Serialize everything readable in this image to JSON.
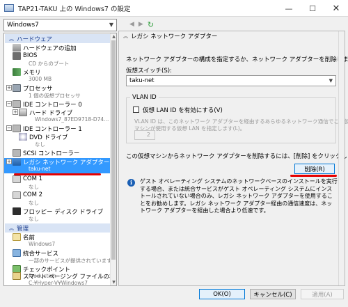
{
  "window": {
    "title": "TAP21-TAKU 上の Windows7 の設定",
    "minimize_glyph": "—",
    "maximize_glyph": "☐",
    "close_glyph": "✕"
  },
  "left": {
    "vm_select": "Windows7",
    "hardware_header": "ハードウェア",
    "management_header": "管理",
    "items": [
      {
        "label": "ハードウェアの追加",
        "sub": ""
      },
      {
        "label": "BIOS",
        "sub": "CD からのブート"
      },
      {
        "label": "メモリ",
        "sub": "3000 MB"
      },
      {
        "label": "プロセッサ",
        "sub": "1 個の仮想プロセッサ"
      },
      {
        "label": "IDE コントローラー 0",
        "sub": ""
      },
      {
        "label": "ハード ドライブ",
        "sub": "Windows7_87ED9718-D74..."
      },
      {
        "label": "IDE コントローラー 1",
        "sub": ""
      },
      {
        "label": "DVD ドライブ",
        "sub": "なし"
      },
      {
        "label": "SCSI コントローラー",
        "sub": ""
      },
      {
        "label": "レガシ ネットワーク アダプター",
        "sub": "taku-net"
      },
      {
        "label": "COM 1",
        "sub": "なし"
      },
      {
        "label": "COM 2",
        "sub": "なし"
      },
      {
        "label": "フロッピー ディスク ドライブ",
        "sub": "なし"
      }
    ],
    "mgmt_items": [
      {
        "label": "名前",
        "sub": "Windows7"
      },
      {
        "label": "統合サービス",
        "sub": "一部のサービスが提供されています"
      },
      {
        "label": "チェックポイント",
        "sub": "Production"
      },
      {
        "label": "スマート ページング ファイルの場所",
        "sub": "C:¥Hyper-V¥Windows7"
      }
    ]
  },
  "right": {
    "section_title": "レガシ ネットワーク アダプター",
    "description": "ネットワーク アダプターの構成を指定するか、ネットワーク アダプターを削除します。",
    "switch_label": "仮想スイッチ(S):",
    "switch_value": "taku-net",
    "vlan_group": "VLAN ID",
    "vlan_checkbox": "仮想 LAN ID を有効にする(V)",
    "vlan_desc_1": "VLAN ID は、このネットワーク アダプターを経由するあらゆるネットワーク通信でこの仮想",
    "vlan_desc_2": "マシンが使用する仮想 LAN を指定します(L)。",
    "vlan_value": "2",
    "remove_desc": "この仮想マシンからネットワーク アダプターを削除するには、[削除] をクリックします。",
    "remove_button": "削除(R)",
    "info_text": "ゲスト オペレーティング システムのネットワークベースのインストールを実行する場合、または統合サービスがゲスト オペレーティング システムにインストールされていない場合のみ、レガシ ネットワーク アダプターを使用することをお勧めします。レガシ ネットワーク アダプター経由の通信速度は、ネットワーク アダプターを経由した場合より低速です。"
  },
  "footer": {
    "ok": "OK(O)",
    "cancel": "キャンセル(C)",
    "apply": "適用(A)"
  },
  "colors": {
    "selection": "#3399ff",
    "annotation": "#e60000",
    "section_header": "#d9e4f5"
  }
}
